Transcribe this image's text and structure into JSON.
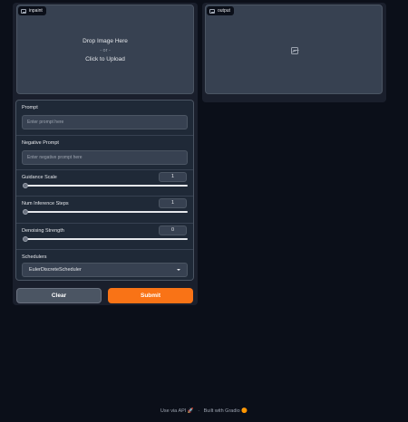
{
  "inpaint": {
    "label": "inpaint",
    "drop_text": "Drop Image Here",
    "or_text": "- or -",
    "click_text": "Click to Upload"
  },
  "output": {
    "label": "output"
  },
  "prompt": {
    "label": "Prompt",
    "placeholder": "Enter prompt here",
    "value": ""
  },
  "negative_prompt": {
    "label": "Negative Prompt",
    "placeholder": "Enter negative prompt here",
    "value": ""
  },
  "guidance_scale": {
    "label": "Guidance Scale",
    "value": "1"
  },
  "num_inference_steps": {
    "label": "Num Inference Steps",
    "value": "1"
  },
  "denoising_strength": {
    "label": "Denoising Strength",
    "value": "0"
  },
  "schedulers": {
    "label": "Schedulers",
    "selected": "EulerDiscreteScheduler"
  },
  "buttons": {
    "clear": "Clear",
    "submit": "Submit"
  },
  "footer": {
    "api": "Use via API",
    "api_icon": "🚀",
    "sep": "·",
    "built": "Built with Gradio",
    "built_icon": "🟠"
  },
  "icons": {
    "image_tag": "image-icon",
    "output_placeholder": "image-placeholder-icon"
  },
  "colors": {
    "accent": "#f97316",
    "background": "#0b0f19"
  }
}
